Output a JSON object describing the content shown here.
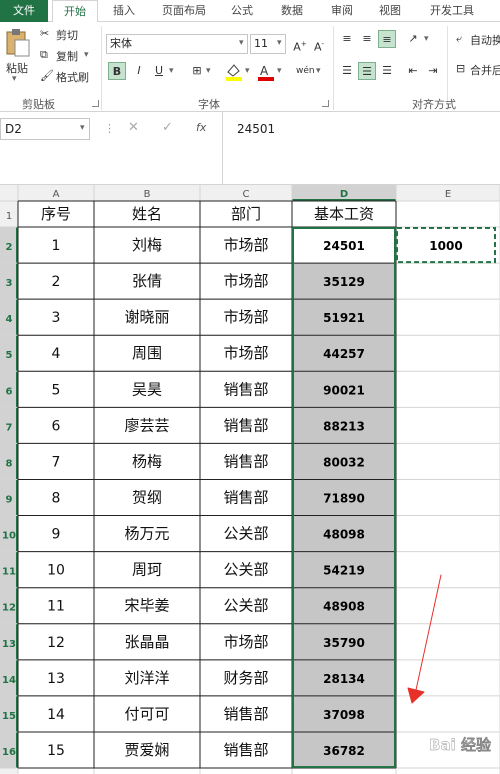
{
  "tabs": [
    "文件",
    "开始",
    "插入",
    "页面布局",
    "公式",
    "数据",
    "审阅",
    "视图",
    "开发工具"
  ],
  "ribbon": {
    "paste": "粘贴",
    "cut": "剪切",
    "copy": "复制",
    "format_painter": "格式刷",
    "clipboard_group": "剪贴板",
    "font_name": "宋体",
    "font_size": "11",
    "bold": "B",
    "italic": "I",
    "underline": "U",
    "font_group": "字体",
    "wrap_text": "自动换",
    "merge": "合并后",
    "align_group": "对齐方式",
    "font_color_hex": "#e00000",
    "highlight_hex": "#ffff00"
  },
  "formula_bar": {
    "name_box": "D2",
    "fx": "fx",
    "content": "24501"
  },
  "columns": [
    "A",
    "B",
    "C",
    "D",
    "E"
  ],
  "header_row": {
    "a": "序号",
    "b": "姓名",
    "c": "部门",
    "d": "基本工资"
  },
  "rows": [
    {
      "num": "2",
      "a": "1",
      "b": "刘梅",
      "c": "市场部",
      "d": "24501"
    },
    {
      "num": "3",
      "a": "2",
      "b": "张倩",
      "c": "市场部",
      "d": "35129"
    },
    {
      "num": "4",
      "a": "3",
      "b": "谢晓丽",
      "c": "市场部",
      "d": "51921"
    },
    {
      "num": "5",
      "a": "4",
      "b": "周围",
      "c": "市场部",
      "d": "44257"
    },
    {
      "num": "6",
      "a": "5",
      "b": "吴昊",
      "c": "销售部",
      "d": "90021"
    },
    {
      "num": "7",
      "a": "6",
      "b": "廖芸芸",
      "c": "销售部",
      "d": "88213"
    },
    {
      "num": "8",
      "a": "7",
      "b": "杨梅",
      "c": "销售部",
      "d": "80032"
    },
    {
      "num": "9",
      "a": "8",
      "b": "贺纲",
      "c": "销售部",
      "d": "71890"
    },
    {
      "num": "10",
      "a": "9",
      "b": "杨万元",
      "c": "公关部",
      "d": "48098"
    },
    {
      "num": "11",
      "a": "10",
      "b": "周珂",
      "c": "公关部",
      "d": "54219"
    },
    {
      "num": "12",
      "a": "11",
      "b": "宋毕姜",
      "c": "公关部",
      "d": "48908"
    },
    {
      "num": "13",
      "a": "12",
      "b": "张晶晶",
      "c": "市场部",
      "d": "35790"
    },
    {
      "num": "14",
      "a": "13",
      "b": "刘洋洋",
      "c": "财务部",
      "d": "28134"
    },
    {
      "num": "15",
      "a": "14",
      "b": "付可可",
      "c": "销售部",
      "d": "37098"
    },
    {
      "num": "16",
      "a": "15",
      "b": "贾爱娴",
      "c": "销售部",
      "d": "36782"
    }
  ],
  "header_row_num": "1",
  "copied_cell": "1000",
  "watermark": "Bai 经验",
  "colors": {
    "excel_green": "#217346",
    "selection_fill": "#c6c6c6",
    "arrow": "#e8302a"
  }
}
